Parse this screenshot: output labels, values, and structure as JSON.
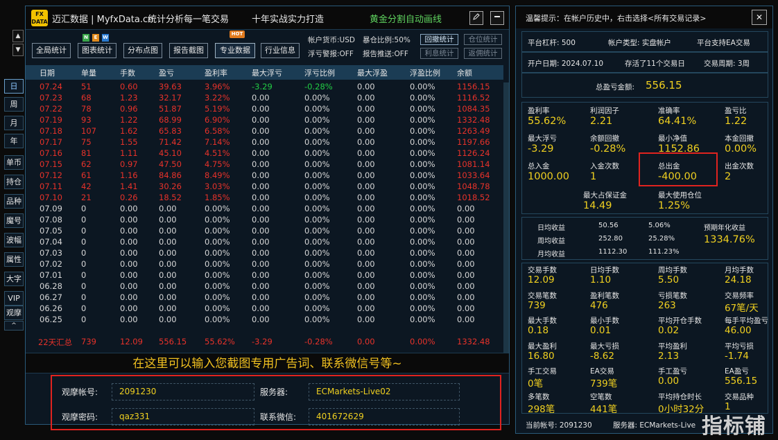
{
  "window": {
    "logo": "FX DATA",
    "app_name": "迈汇数据 | MyfxData.cn",
    "tagline": "统计分析每一笔交易",
    "slogan": "十年实战实力打造",
    "promo": "黄金分割自动画线",
    "edit_icon": "pencil-icon",
    "min_icon": "minimize-icon"
  },
  "toolbar": {
    "buttons": [
      "全局统计",
      "图表统计",
      "分布点图",
      "报告截图",
      "专业数据",
      "行业信息"
    ],
    "badges": {
      "new": [
        "N",
        "E",
        "W"
      ],
      "hot": "HOT"
    },
    "info": {
      "currency": "帐户货币:USD",
      "leverage_risk": "暴仓比例:50%",
      "float_alert": "浮亏警报:OFF",
      "report_push": "报告推送:OFF"
    },
    "small_buttons": [
      "回撤统计",
      "仓位统计",
      "利息统计",
      "返佣统计"
    ]
  },
  "nav": {
    "up": "▲",
    "down": "▼",
    "items": [
      "日",
      "周",
      "月",
      "年",
      "单币",
      "持仓",
      "品种",
      "魔号",
      "波幅",
      "属性",
      "大字",
      "VIP",
      "观摩"
    ],
    "active": "日",
    "collapse": "^"
  },
  "table": {
    "headers": [
      "日期",
      "单量",
      "手数",
      "盈亏",
      "盈利率",
      "最大浮亏",
      "浮亏比例",
      "最大浮盈",
      "浮盈比例",
      "余额"
    ],
    "rows": [
      [
        "07.24",
        "51",
        "0.60",
        "39.63",
        "3.96%",
        "-3.29",
        "-0.28%",
        "0.00",
        "0.00%",
        "1156.15"
      ],
      [
        "07.23",
        "68",
        "1.23",
        "32.17",
        "3.22%",
        "0.00",
        "0.00%",
        "0.00",
        "0.00%",
        "1116.52"
      ],
      [
        "07.22",
        "78",
        "0.96",
        "51.87",
        "5.19%",
        "0.00",
        "0.00%",
        "0.00",
        "0.00%",
        "1084.35"
      ],
      [
        "07.19",
        "93",
        "1.22",
        "68.99",
        "6.90%",
        "0.00",
        "0.00%",
        "0.00",
        "0.00%",
        "1332.48"
      ],
      [
        "07.18",
        "107",
        "1.62",
        "65.83",
        "6.58%",
        "0.00",
        "0.00%",
        "0.00",
        "0.00%",
        "1263.49"
      ],
      [
        "07.17",
        "75",
        "1.55",
        "71.42",
        "7.14%",
        "0.00",
        "0.00%",
        "0.00",
        "0.00%",
        "1197.66"
      ],
      [
        "07.16",
        "81",
        "1.11",
        "45.10",
        "4.51%",
        "0.00",
        "0.00%",
        "0.00",
        "0.00%",
        "1126.24"
      ],
      [
        "07.15",
        "62",
        "0.97",
        "47.50",
        "4.75%",
        "0.00",
        "0.00%",
        "0.00",
        "0.00%",
        "1081.14"
      ],
      [
        "07.12",
        "61",
        "1.16",
        "84.86",
        "8.49%",
        "0.00",
        "0.00%",
        "0.00",
        "0.00%",
        "1033.64"
      ],
      [
        "07.11",
        "42",
        "1.41",
        "30.26",
        "3.03%",
        "0.00",
        "0.00%",
        "0.00",
        "0.00%",
        "1048.78"
      ],
      [
        "07.10",
        "21",
        "0.26",
        "18.52",
        "1.85%",
        "0.00",
        "0.00%",
        "0.00",
        "0.00%",
        "1018.52"
      ],
      [
        "07.09",
        "0",
        "0.00",
        "0.00",
        "0.00%",
        "0.00",
        "0.00%",
        "0.00",
        "0.00%",
        "0.00"
      ],
      [
        "07.08",
        "0",
        "0.00",
        "0.00",
        "0.00%",
        "0.00",
        "0.00%",
        "0.00",
        "0.00%",
        "0.00"
      ],
      [
        "07.05",
        "0",
        "0.00",
        "0.00",
        "0.00%",
        "0.00",
        "0.00%",
        "0.00",
        "0.00%",
        "0.00"
      ],
      [
        "07.04",
        "0",
        "0.00",
        "0.00",
        "0.00%",
        "0.00",
        "0.00%",
        "0.00",
        "0.00%",
        "0.00"
      ],
      [
        "07.03",
        "0",
        "0.00",
        "0.00",
        "0.00%",
        "0.00",
        "0.00%",
        "0.00",
        "0.00%",
        "0.00"
      ],
      [
        "07.02",
        "0",
        "0.00",
        "0.00",
        "0.00%",
        "0.00",
        "0.00%",
        "0.00",
        "0.00%",
        "0.00"
      ],
      [
        "07.01",
        "0",
        "0.00",
        "0.00",
        "0.00%",
        "0.00",
        "0.00%",
        "0.00",
        "0.00%",
        "0.00"
      ],
      [
        "06.28",
        "0",
        "0.00",
        "0.00",
        "0.00%",
        "0.00",
        "0.00%",
        "0.00",
        "0.00%",
        "0.00"
      ],
      [
        "06.27",
        "0",
        "0.00",
        "0.00",
        "0.00%",
        "0.00",
        "0.00%",
        "0.00",
        "0.00%",
        "0.00"
      ],
      [
        "06.26",
        "0",
        "0.00",
        "0.00",
        "0.00%",
        "0.00",
        "0.00%",
        "0.00",
        "0.00%",
        "0.00"
      ],
      [
        "06.25",
        "0",
        "0.00",
        "0.00",
        "0.00%",
        "0.00",
        "0.00%",
        "0.00",
        "0.00%",
        "0.00"
      ]
    ],
    "summary": [
      "22天汇总",
      "739",
      "12.09",
      "556.15",
      "55.62%",
      "-3.29",
      "-0.28%",
      "0.00",
      "0.00%",
      "1332.48"
    ]
  },
  "colors": {
    "profit": "#e8322a",
    "zero": "#d8d8d8",
    "float_loss": "#22cc44",
    "value": "#f0d020"
  },
  "ad_text": "在这里可以输入您截图专用广告词、联系微信号等~",
  "watch": {
    "account_label": "观摩帐号:",
    "account": "2091230",
    "server_label": "服务器:",
    "server": "ECMarkets-Live02",
    "password_label": "观摩密码:",
    "password": "qaz331",
    "wechat_label": "联系微信:",
    "wechat": "401672629"
  },
  "right": {
    "tip": "温馨提示：在帐户历史中，右击选择<所有交易记录>",
    "close": "✕",
    "platform_leverage": "平台杠杆: 500",
    "account_type": "帐户类型: 实盘帐户",
    "ea_support": "平台支持EA交易",
    "open_date": "开户日期: 2024.07.10",
    "stored": "存活了11个交易日",
    "period": "交易周期: 3周",
    "total_pnl_label": "总盈亏金额:",
    "total_pnl": "556.15",
    "grid1": [
      {
        "l": "盈利率",
        "v": "55.62%"
      },
      {
        "l": "利润因子",
        "v": "2.21"
      },
      {
        "l": "准确率",
        "v": "64.41%"
      },
      {
        "l": "盈亏比",
        "v": "1.22"
      },
      {
        "l": "最大浮亏",
        "v": "-3.29"
      },
      {
        "l": "余额回撤",
        "v": "-0.28%"
      },
      {
        "l": "最小净值",
        "v": "1152.86"
      },
      {
        "l": "本金回撤",
        "v": "0.00%"
      },
      {
        "l": "总入金",
        "v": "1000.00"
      },
      {
        "l": "入金次数",
        "v": "1"
      },
      {
        "l": "总出金",
        "v": "-400.00"
      },
      {
        "l": "出金次数",
        "v": "2"
      }
    ],
    "margin": {
      "l": "最大占保证金",
      "v": "14.49"
    },
    "maxpos": {
      "l": "最大使用仓位",
      "v": "1.25%"
    },
    "income": [
      [
        "日均收益",
        "50.56",
        "5.06%"
      ],
      [
        "周均收益",
        "252.80",
        "25.28%"
      ],
      [
        "月均收益",
        "1112.30",
        "111.23%"
      ]
    ],
    "annual_label": "预期年化收益",
    "annual": "1334.76%",
    "grid2": [
      {
        "l": "交易手数",
        "v": "12.09"
      },
      {
        "l": "日均手数",
        "v": "1.10"
      },
      {
        "l": "周均手数",
        "v": "5.50"
      },
      {
        "l": "月均手数",
        "v": "24.18"
      },
      {
        "l": "交易笔数",
        "v": "739"
      },
      {
        "l": "盈利笔数",
        "v": "476"
      },
      {
        "l": "亏损笔数",
        "v": "263"
      },
      {
        "l": "交易频率",
        "v": "67笔/天"
      },
      {
        "l": "最大手数",
        "v": "0.18"
      },
      {
        "l": "最小手数",
        "v": "0.01"
      },
      {
        "l": "平均开仓手数",
        "v": "0.02"
      },
      {
        "l": "每手平均盈亏",
        "v": "46.00"
      },
      {
        "l": "最大盈利",
        "v": "16.80"
      },
      {
        "l": "最大亏损",
        "v": "-8.62"
      },
      {
        "l": "平均盈利",
        "v": "2.13"
      },
      {
        "l": "平均亏损",
        "v": "-1.74"
      },
      {
        "l": "手工交易",
        "v": "0笔"
      },
      {
        "l": "EA交易",
        "v": "739笔"
      },
      {
        "l": "手工盈亏",
        "v": "0.00"
      },
      {
        "l": "EA盈亏",
        "v": "556.15"
      },
      {
        "l": "多笔数",
        "v": "298笔"
      },
      {
        "l": "空笔数",
        "v": "441笔"
      },
      {
        "l": "平均持仓时长",
        "v": "0小时32分"
      },
      {
        "l": "交易品种",
        "v": "1"
      }
    ],
    "current_account": "当前帐号: 2091230",
    "current_server": "服务器: ECMarkets-Live"
  },
  "watermark": "指标铺"
}
